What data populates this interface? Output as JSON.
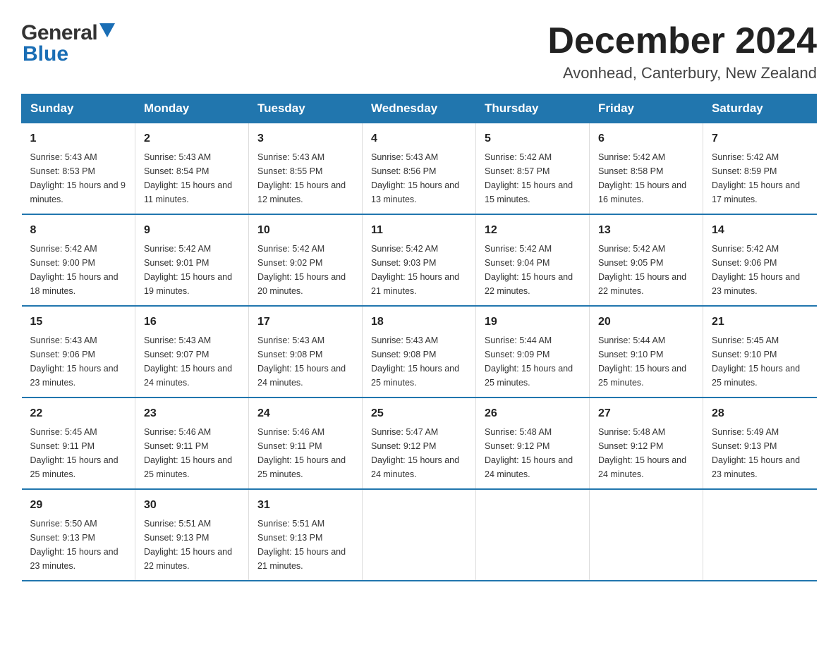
{
  "header": {
    "month_title": "December 2024",
    "location": "Avonhead, Canterbury, New Zealand",
    "logo_general": "General",
    "logo_blue": "Blue"
  },
  "days_of_week": [
    "Sunday",
    "Monday",
    "Tuesday",
    "Wednesday",
    "Thursday",
    "Friday",
    "Saturday"
  ],
  "weeks": [
    [
      {
        "day": "1",
        "sunrise": "5:43 AM",
        "sunset": "8:53 PM",
        "daylight": "15 hours and 9 minutes."
      },
      {
        "day": "2",
        "sunrise": "5:43 AM",
        "sunset": "8:54 PM",
        "daylight": "15 hours and 11 minutes."
      },
      {
        "day": "3",
        "sunrise": "5:43 AM",
        "sunset": "8:55 PM",
        "daylight": "15 hours and 12 minutes."
      },
      {
        "day": "4",
        "sunrise": "5:43 AM",
        "sunset": "8:56 PM",
        "daylight": "15 hours and 13 minutes."
      },
      {
        "day": "5",
        "sunrise": "5:42 AM",
        "sunset": "8:57 PM",
        "daylight": "15 hours and 15 minutes."
      },
      {
        "day": "6",
        "sunrise": "5:42 AM",
        "sunset": "8:58 PM",
        "daylight": "15 hours and 16 minutes."
      },
      {
        "day": "7",
        "sunrise": "5:42 AM",
        "sunset": "8:59 PM",
        "daylight": "15 hours and 17 minutes."
      }
    ],
    [
      {
        "day": "8",
        "sunrise": "5:42 AM",
        "sunset": "9:00 PM",
        "daylight": "15 hours and 18 minutes."
      },
      {
        "day": "9",
        "sunrise": "5:42 AM",
        "sunset": "9:01 PM",
        "daylight": "15 hours and 19 minutes."
      },
      {
        "day": "10",
        "sunrise": "5:42 AM",
        "sunset": "9:02 PM",
        "daylight": "15 hours and 20 minutes."
      },
      {
        "day": "11",
        "sunrise": "5:42 AM",
        "sunset": "9:03 PM",
        "daylight": "15 hours and 21 minutes."
      },
      {
        "day": "12",
        "sunrise": "5:42 AM",
        "sunset": "9:04 PM",
        "daylight": "15 hours and 22 minutes."
      },
      {
        "day": "13",
        "sunrise": "5:42 AM",
        "sunset": "9:05 PM",
        "daylight": "15 hours and 22 minutes."
      },
      {
        "day": "14",
        "sunrise": "5:42 AM",
        "sunset": "9:06 PM",
        "daylight": "15 hours and 23 minutes."
      }
    ],
    [
      {
        "day": "15",
        "sunrise": "5:43 AM",
        "sunset": "9:06 PM",
        "daylight": "15 hours and 23 minutes."
      },
      {
        "day": "16",
        "sunrise": "5:43 AM",
        "sunset": "9:07 PM",
        "daylight": "15 hours and 24 minutes."
      },
      {
        "day": "17",
        "sunrise": "5:43 AM",
        "sunset": "9:08 PM",
        "daylight": "15 hours and 24 minutes."
      },
      {
        "day": "18",
        "sunrise": "5:43 AM",
        "sunset": "9:08 PM",
        "daylight": "15 hours and 25 minutes."
      },
      {
        "day": "19",
        "sunrise": "5:44 AM",
        "sunset": "9:09 PM",
        "daylight": "15 hours and 25 minutes."
      },
      {
        "day": "20",
        "sunrise": "5:44 AM",
        "sunset": "9:10 PM",
        "daylight": "15 hours and 25 minutes."
      },
      {
        "day": "21",
        "sunrise": "5:45 AM",
        "sunset": "9:10 PM",
        "daylight": "15 hours and 25 minutes."
      }
    ],
    [
      {
        "day": "22",
        "sunrise": "5:45 AM",
        "sunset": "9:11 PM",
        "daylight": "15 hours and 25 minutes."
      },
      {
        "day": "23",
        "sunrise": "5:46 AM",
        "sunset": "9:11 PM",
        "daylight": "15 hours and 25 minutes."
      },
      {
        "day": "24",
        "sunrise": "5:46 AM",
        "sunset": "9:11 PM",
        "daylight": "15 hours and 25 minutes."
      },
      {
        "day": "25",
        "sunrise": "5:47 AM",
        "sunset": "9:12 PM",
        "daylight": "15 hours and 24 minutes."
      },
      {
        "day": "26",
        "sunrise": "5:48 AM",
        "sunset": "9:12 PM",
        "daylight": "15 hours and 24 minutes."
      },
      {
        "day": "27",
        "sunrise": "5:48 AM",
        "sunset": "9:12 PM",
        "daylight": "15 hours and 24 minutes."
      },
      {
        "day": "28",
        "sunrise": "5:49 AM",
        "sunset": "9:13 PM",
        "daylight": "15 hours and 23 minutes."
      }
    ],
    [
      {
        "day": "29",
        "sunrise": "5:50 AM",
        "sunset": "9:13 PM",
        "daylight": "15 hours and 23 minutes."
      },
      {
        "day": "30",
        "sunrise": "5:51 AM",
        "sunset": "9:13 PM",
        "daylight": "15 hours and 22 minutes."
      },
      {
        "day": "31",
        "sunrise": "5:51 AM",
        "sunset": "9:13 PM",
        "daylight": "15 hours and 21 minutes."
      },
      null,
      null,
      null,
      null
    ]
  ]
}
